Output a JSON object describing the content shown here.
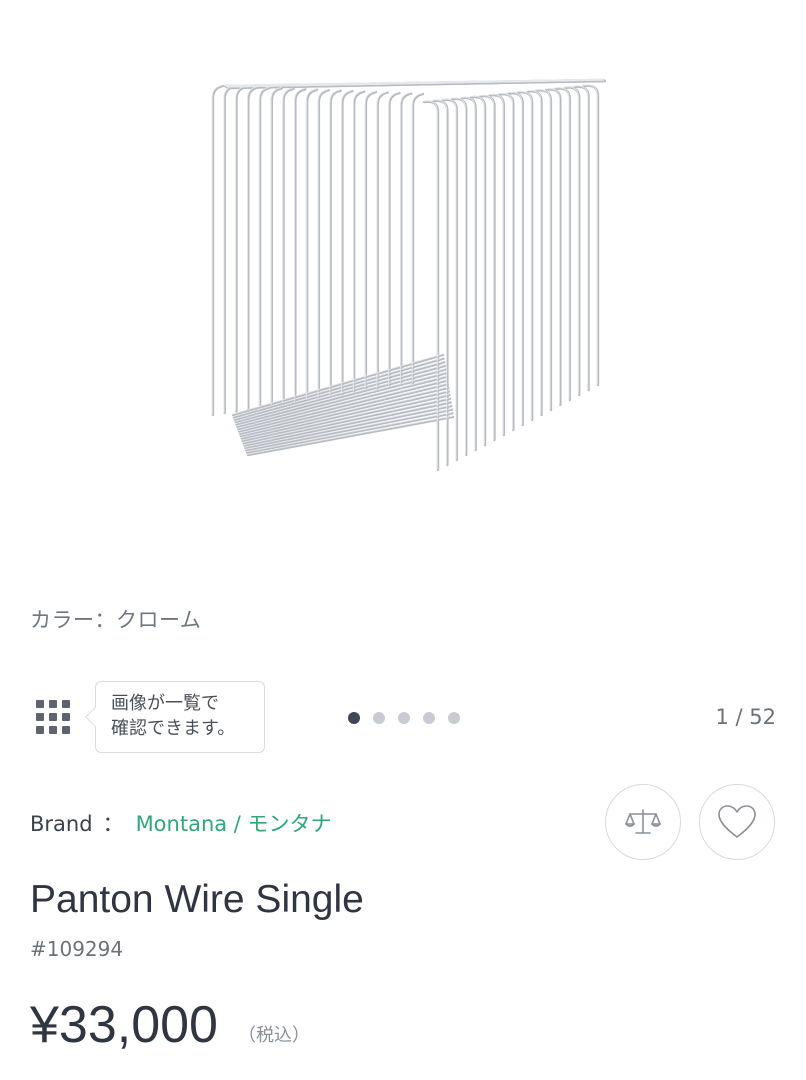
{
  "product_image": {
    "icon": "panton-wire-cube",
    "alt": "Panton Wire Single chrome wire shelf"
  },
  "color_label": "カラー：クローム",
  "gallery": {
    "grid_icon": "grid-icon",
    "tooltip_line1": "画像が一覧で",
    "tooltip_line2": "確認できます。",
    "dots_total": 5,
    "active_dot": 0,
    "counter": "1 / 52"
  },
  "brand": {
    "label": "Brand",
    "separator": "：",
    "value": "Montana / モンタナ",
    "color": "#2ea77b"
  },
  "actions": {
    "compare_icon": "scale-icon",
    "favorite_icon": "heart-icon"
  },
  "product": {
    "title": "Panton Wire Single",
    "sku": "#109294",
    "price": "¥33,000",
    "tax_note": "（税込）"
  }
}
